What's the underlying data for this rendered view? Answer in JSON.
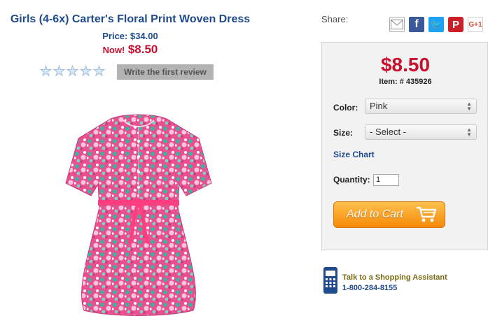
{
  "product": {
    "title": "Girls (4-6x) Carter's Floral Print Woven Dress",
    "price_text": "Price: $34.00",
    "now_label": "Now!",
    "now_price": "$8.50",
    "rating": {
      "stars": 0,
      "max": 5
    },
    "review_button": "Write the first review"
  },
  "share": {
    "label": "Share:",
    "icons": [
      "email-icon",
      "facebook-icon",
      "twitter-icon",
      "pinterest-icon",
      "google-plus-icon"
    ],
    "facebook_glyph": "f",
    "twitter_glyph": "🐦",
    "pinterest_glyph": "P",
    "google_plus_glyph": "G+1"
  },
  "purchase": {
    "price": "$8.50",
    "item_number": "Item: # 435926",
    "color_label": "Color:",
    "color_value": "Pink",
    "size_label": "Size:",
    "size_value": "- Select -",
    "size_chart": "Size Chart",
    "quantity_label": "Quantity:",
    "quantity_value": "1",
    "add_to_cart": "Add to Cart"
  },
  "assistant": {
    "title": "Talk to a Shopping Assistant",
    "phone": "1-800-284-8155"
  },
  "colors": {
    "title_blue": "#1f4a8c",
    "price_red": "#c8102e",
    "cart_orange": "#f58a07",
    "dress_pink": "#e9508f",
    "dress_teal": "#3bb3a3"
  }
}
